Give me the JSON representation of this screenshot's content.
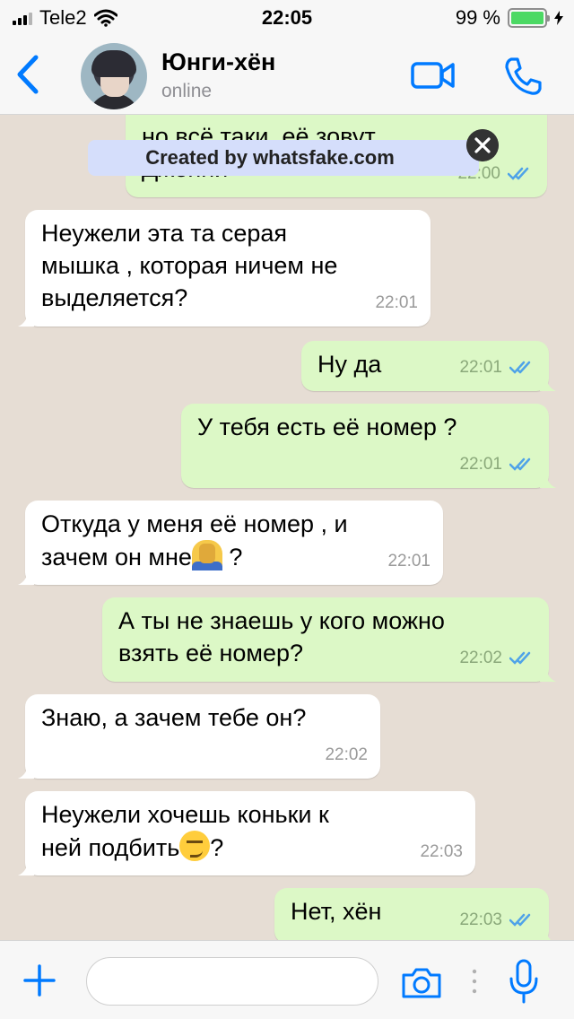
{
  "status_bar": {
    "carrier": "Tele2",
    "time": "22:05",
    "battery_percent": "99 %",
    "battery_level": 0.99
  },
  "header": {
    "contact_name": "Юнги-хён",
    "contact_status": "online"
  },
  "watermark": {
    "text": "Created by whatsfake.com"
  },
  "messages": [
    {
      "direction": "out",
      "text": "но всё таки, её зовут\nДженни",
      "time": "22:00",
      "read": true
    },
    {
      "direction": "in",
      "text": "Неужели эта та серая\nмышка , которая ничем не\nвыделяется?",
      "time": "22:01"
    },
    {
      "direction": "out",
      "text": "Ну да",
      "time": "22:01",
      "read": true
    },
    {
      "direction": "out",
      "text": "У тебя есть её номер ?",
      "time": "22:01",
      "read": true
    },
    {
      "direction": "in",
      "text_before_emoji": "Откуда у меня её номер , и\nзачем он мне",
      "emoji": "face-palm-emoji",
      "text_after_emoji": " ?",
      "time": "22:01"
    },
    {
      "direction": "out",
      "text": "А ты не знаешь у кого можно\nвзять её номер?",
      "time": "22:02",
      "read": true
    },
    {
      "direction": "in",
      "text": "Знаю, а зачем тебе он?",
      "time": "22:02"
    },
    {
      "direction": "in",
      "text_before_emoji": "Неужели хочешь коньки к\nней подбить",
      "emoji": "smirking-face-emoji",
      "text_after_emoji": "?",
      "time": "22:03"
    },
    {
      "direction": "out",
      "text": "Нет, хён",
      "time": "22:03",
      "read": true
    }
  ],
  "input": {
    "value": "",
    "placeholder": ""
  },
  "colors": {
    "accent": "#007aff",
    "outgoing_bubble": "#dcf8c6",
    "incoming_bubble": "#ffffff",
    "read_ticks": "#4fa3e8",
    "chat_background": "#e6ddd4"
  }
}
